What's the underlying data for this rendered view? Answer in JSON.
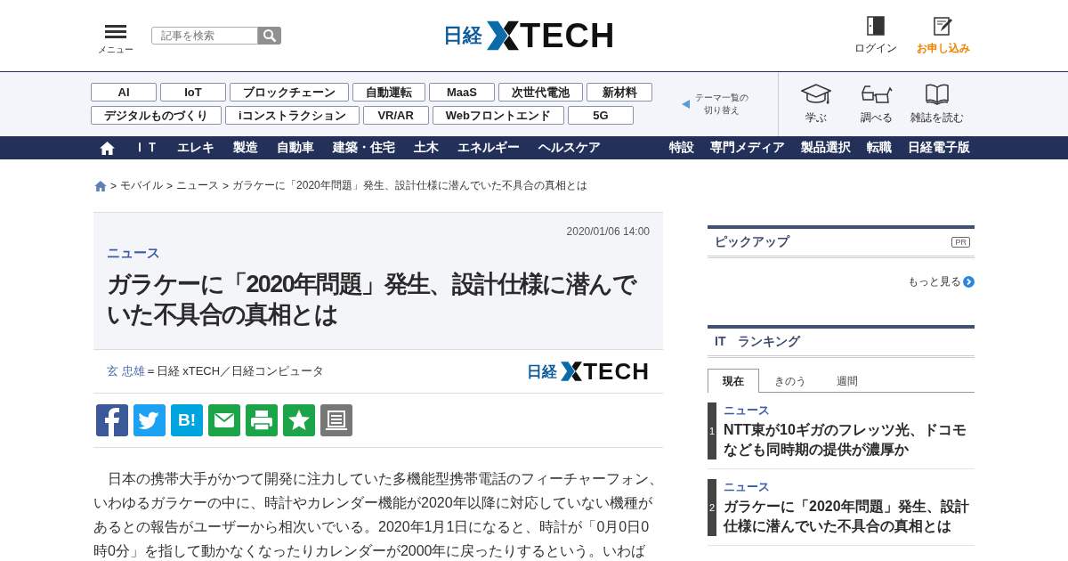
{
  "header": {
    "menu_label": "メニュー",
    "search": {
      "placeholder": "記事を検索"
    },
    "logo": {
      "prefix": "日経",
      "name": "TECH"
    },
    "login_label": "ログイン",
    "signup_label": "お申し込み"
  },
  "theme_tags": [
    [
      "AI",
      "IoT",
      "ブロックチェーン",
      "自動運転",
      "MaaS",
      "次世代電池",
      "新材料"
    ],
    [
      "デジタルものづくり",
      "iコンストラクション",
      "VR/AR",
      "Webフロントエンド",
      "5G"
    ]
  ],
  "theme_switch": [
    "テーマ一覧の",
    "切り替え"
  ],
  "quick_links": [
    {
      "kind": "learn",
      "label": "学ぶ"
    },
    {
      "kind": "research",
      "label": "調べる"
    },
    {
      "kind": "magazine",
      "label": "雑誌を読む"
    }
  ],
  "nav": {
    "left": [
      "ＩＴ",
      "エレキ",
      "製造",
      "自動車",
      "建築・住宅",
      "土木",
      "エネルギー",
      "ヘルスケア"
    ],
    "right": [
      "特設",
      "専門メディア",
      "製品選択",
      "転職",
      "日経電子版"
    ]
  },
  "breadcrumb": {
    "separator": ">",
    "items": [
      "モバイル",
      "ニュース",
      "ガラケーに「2020年問題」発生、設計仕様に潜んでいた不具合の真相とは"
    ]
  },
  "article": {
    "date": "2020/01/06 14:00",
    "category": "ニュース",
    "title": "ガラケーに「2020年問題」発生、設計仕様に潜んでいた不具合の真相とは",
    "author": "玄 忠雄",
    "affiliation": "＝日経 xTECH／日経コンピュータ",
    "logo": {
      "prefix": "日経",
      "name": "TECH"
    },
    "share": [
      {
        "kind": "facebook"
      },
      {
        "kind": "twitter"
      },
      {
        "kind": "hatena",
        "label": "B!"
      },
      {
        "kind": "mail"
      },
      {
        "kind": "print"
      },
      {
        "kind": "star"
      },
      {
        "kind": "memo"
      }
    ],
    "body": "日本の携帯大手がかつて開発に注力していた多機能型携帯電話のフィーチャーフォン、いわゆるガラケーの中に、時計やカレンダー機能が2020年以降に対応していない機種があるとの報告がユーザーから相次いでいる。2020年1月1日になると、時計が「0月0日0時0分」を指して動かなくなったりカレンダーが2000年に戻ったりするという。いわば"
  },
  "sidebar": {
    "pickup": {
      "title": "ピックアップ",
      "badge": "PR",
      "more": "もっと見る"
    },
    "ranking": {
      "title": "IT　ランキング",
      "tabs": [
        {
          "label": "現在",
          "selected": true
        },
        {
          "label": "きのう",
          "selected": false
        },
        {
          "label": "週間",
          "selected": false
        }
      ],
      "items": [
        {
          "rank": "1",
          "category": "ニュース",
          "title": "NTT東が10ギガのフレッツ光、ドコモなども同時期の提供が濃厚か"
        },
        {
          "rank": "2",
          "category": "ニュース",
          "title": "ガラケーに「2020年問題」発生、設計仕様に潜んでいた不具合の真相とは"
        }
      ]
    }
  }
}
